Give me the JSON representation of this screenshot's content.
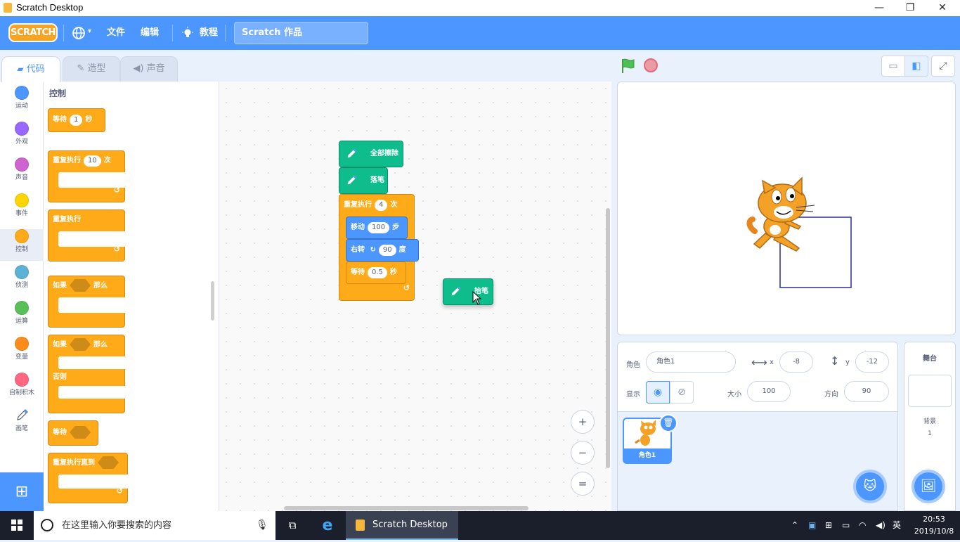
{
  "window": {
    "title": "Scratch Desktop",
    "minimize": "—",
    "restore": "❐",
    "close": "✕"
  },
  "menubar": {
    "logo": "SCRATCH",
    "language_icon": "globe-icon",
    "file": "文件",
    "edit": "编辑",
    "tutorials": "教程",
    "project_title": "Scratch 作品"
  },
  "tabs": [
    {
      "label": "代码"
    },
    {
      "label": "造型"
    },
    {
      "label": "声音"
    }
  ],
  "categories": [
    {
      "label": "运动",
      "color": "#4c97ff"
    },
    {
      "label": "外观",
      "color": "#9966ff"
    },
    {
      "label": "声音",
      "color": "#cf63cf"
    },
    {
      "label": "事件",
      "color": "#ffd500"
    },
    {
      "label": "控制",
      "color": "#ffab19"
    },
    {
      "label": "侦测",
      "color": "#5cb1d6"
    },
    {
      "label": "运算",
      "color": "#59c059"
    },
    {
      "label": "变量",
      "color": "#ff8c1a"
    },
    {
      "label": "自制积木",
      "color": "#ff6680"
    },
    {
      "label": "画笔",
      "color": "pen"
    }
  ],
  "palette": {
    "title": "控制",
    "wait": {
      "label": "等待",
      "value": "1",
      "unit": "秒"
    },
    "repeat": {
      "label": "重复执行",
      "value": "10",
      "unit": "次"
    },
    "forever": {
      "label": "重复执行"
    },
    "if_then": {
      "label": "如果",
      "then": "那么"
    },
    "if_else": {
      "label": "如果",
      "then": "那么",
      "else": "否则"
    },
    "wait_until": {
      "label": "等待"
    },
    "repeat_until": {
      "label": "重复执行直到"
    }
  },
  "script": {
    "clear": "全部擦除",
    "pen_down": "落笔",
    "repeat": {
      "label": "重复执行",
      "value": "4",
      "unit": "次"
    },
    "move": {
      "label": "移动",
      "value": "100",
      "unit": "步"
    },
    "turn": {
      "label": "右转",
      "value": "90",
      "unit": "度"
    },
    "wait": {
      "label": "等待",
      "value": "0.5",
      "unit": "秒"
    },
    "dragging_block": "抬笔"
  },
  "zoom": {
    "in": "+",
    "out": "−",
    "reset": "="
  },
  "sprite_info": {
    "sprite_label": "角色",
    "sprite_name": "角色1",
    "x_label": "x",
    "x": "-8",
    "y_label": "y",
    "y": "-12",
    "show_label": "显示",
    "size_label": "大小",
    "size": "100",
    "direction_label": "方向",
    "direction": "90"
  },
  "sprite_list": [
    {
      "name": "角色1"
    }
  ],
  "stage_pane": {
    "title": "舞台",
    "backdrop_label": "背景",
    "backdrop_count": "1"
  },
  "taskbar": {
    "search_placeholder": "在这里输入你要搜索的内容",
    "app": "Scratch Desktop",
    "ime": "英",
    "time": "20:53",
    "date": "2019/10/8"
  },
  "colors": {
    "accent": "#4c97ff",
    "control": "#ffab19",
    "pen": "#0fbd8c",
    "motion": "#4c97ff"
  }
}
